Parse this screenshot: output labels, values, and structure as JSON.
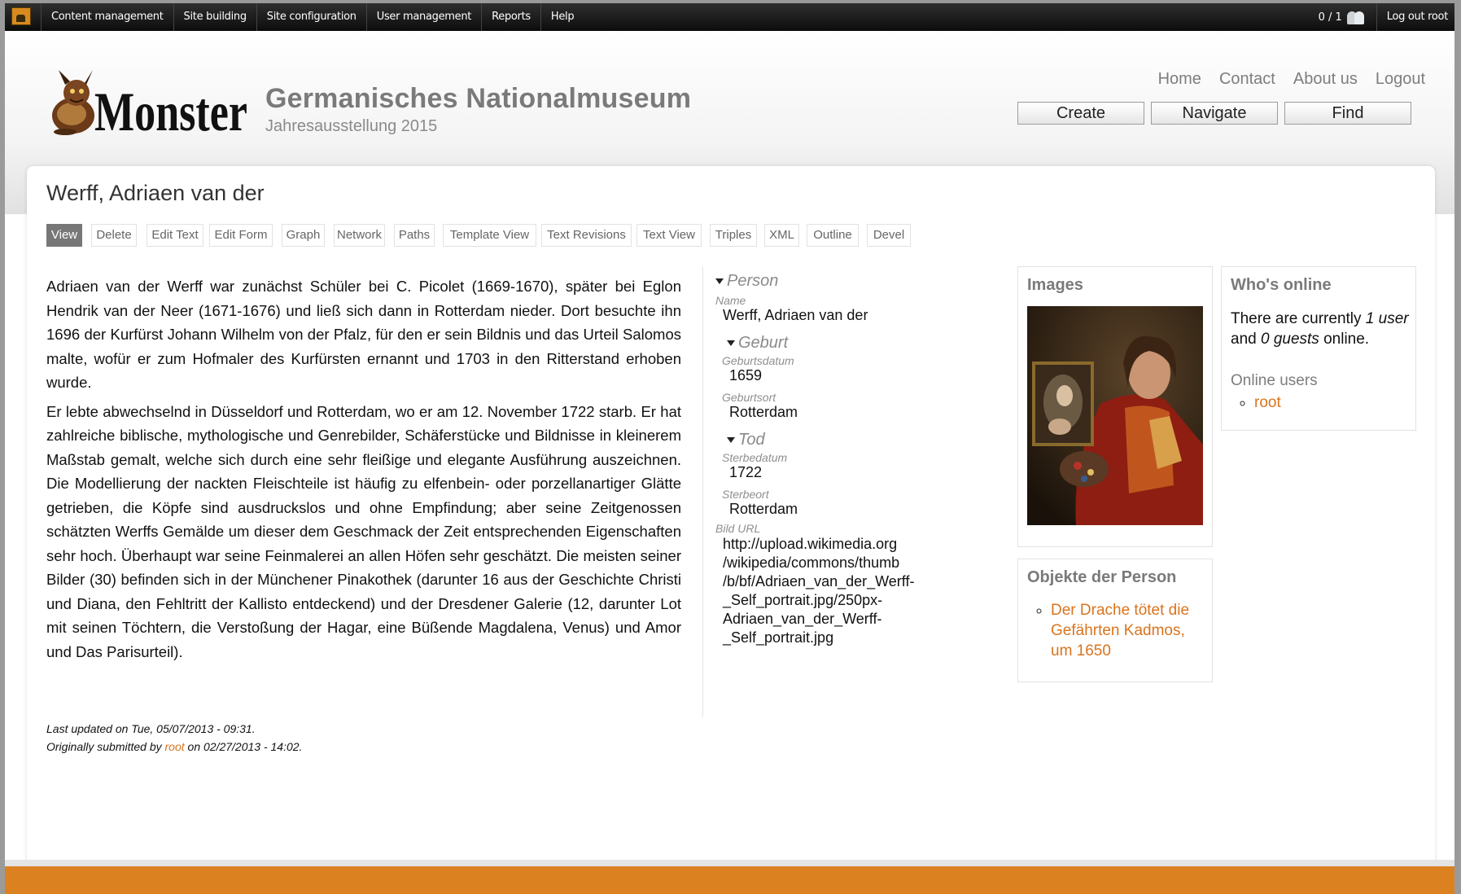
{
  "admin_menu": {
    "items": [
      "Content management",
      "Site building",
      "Site configuration",
      "User management",
      "Reports",
      "Help"
    ],
    "user_count": "0 / 1",
    "logout_label": "Log out root"
  },
  "header": {
    "logo_text": "Monster",
    "site_name": "Germanisches Nationalmuseum",
    "slogan": "Jahresausstellung 2015",
    "secondary_links": [
      "Home",
      "Contact",
      "About us",
      "Logout"
    ],
    "buttons": [
      "Create",
      "Navigate",
      "Find"
    ]
  },
  "page": {
    "title": "Werff, Adriaen van der",
    "tabs": [
      "View",
      "Delete",
      "Edit Text",
      "Edit Form",
      "Graph",
      "Network",
      "Paths",
      "Template View",
      "Text Revisions",
      "Text View",
      "Triples",
      "XML",
      "Outline",
      "Devel"
    ],
    "active_tab": "View",
    "body": [
      "Adriaen van der Werff war zunächst Schüler bei C. Picolet (1669-1670), später bei Eglon Hendrik van der Neer (1671-1676) und ließ sich dann in Rotterdam nieder. Dort besuchte ihn 1696 der Kurfürst Johann Wilhelm von der Pfalz, für den er sein Bildnis und das Urteil Salomos malte, wofür er zum Hofmaler des Kurfürsten ernannt und 1703 in den Ritterstand erhoben wurde.",
      "Er lebte abwechselnd in Düsseldorf und Rotterdam, wo er am 12. November 1722 starb. Er hat zahlreiche biblische, mythologische und Genrebilder, Schäferstücke und Bildnisse in kleinerem Maßstab gemalt, welche sich durch eine sehr fleißige und elegante Ausführung auszeichnen. Die Modellierung der nackten Fleischteile ist häufig zu elfenbein- oder porzellanartiger Glätte getrieben, die Köpfe sind ausdruckslos und ohne Empfindung; aber seine Zeitgenossen schätzten Werffs Gemälde um dieser dem Geschmack der Zeit entsprechenden Eigenschaften sehr hoch. Überhaupt war seine Feinmalerei an allen Höfen sehr geschätzt. Die meisten seiner Bilder (30) befinden sich in der Münchener Pinakothek (darunter 16 aus der Geschichte Christi und Diana, den Fehltritt der Kallisto entdeckend) und der Dresdener Galerie (12, darunter Lot mit seinen Töchtern, die Verstoßung der Hagar, eine Büßende Magdalena, Venus) und Amor und Das Parisurteil)."
    ],
    "meta": {
      "updated": "Last updated on Tue, 05/07/2013 - 09:31.",
      "submitted_prefix": "Originally submitted by",
      "submitted_user": "root",
      "submitted_suffix": "on 02/27/2013 - 14:02."
    }
  },
  "fields": {
    "person_heading": "Person",
    "name_label": "Name",
    "name_value": "Werff, Adriaen van der",
    "geburt_heading": "Geburt",
    "geburtsdatum_label": "Geburtsdatum",
    "geburtsdatum_value": "1659",
    "geburtsort_label": "Geburtsort",
    "geburtsort_value": "Rotterdam",
    "tod_heading": "Tod",
    "sterbedatum_label": "Sterbedatum",
    "sterbedatum_value": "1722",
    "sterbeort_label": "Sterbeort",
    "sterbeort_value": "Rotterdam",
    "bild_url_label": "Bild URL",
    "bild_url_lines": [
      "http://upload.wikimedia.org",
      "/wikipedia/commons/thumb",
      "/b/bf/Adriaen_van_der_Werff-",
      "_Self_portrait.jpg/250px-",
      "Adriaen_van_der_Werff-",
      "_Self_portrait.jpg"
    ]
  },
  "blocks": {
    "images_title": "Images",
    "objekte_title": "Objekte der Person",
    "objekte_items": [
      "Der Drache tötet die Gefährten Kadmos, um 1650"
    ],
    "online_title": "Who's online",
    "online_text_1": "There are currently",
    "online_users_count": "1 user",
    "online_text_2": "and",
    "online_guests": "0 guests",
    "online_text_3": "online.",
    "online_users_label": "Online users",
    "online_users": [
      "root"
    ]
  },
  "colors": {
    "accent": "#d9741d",
    "footer": "#db8120",
    "admin_bar": "#1a1a1a",
    "active_tab": "#777777"
  }
}
